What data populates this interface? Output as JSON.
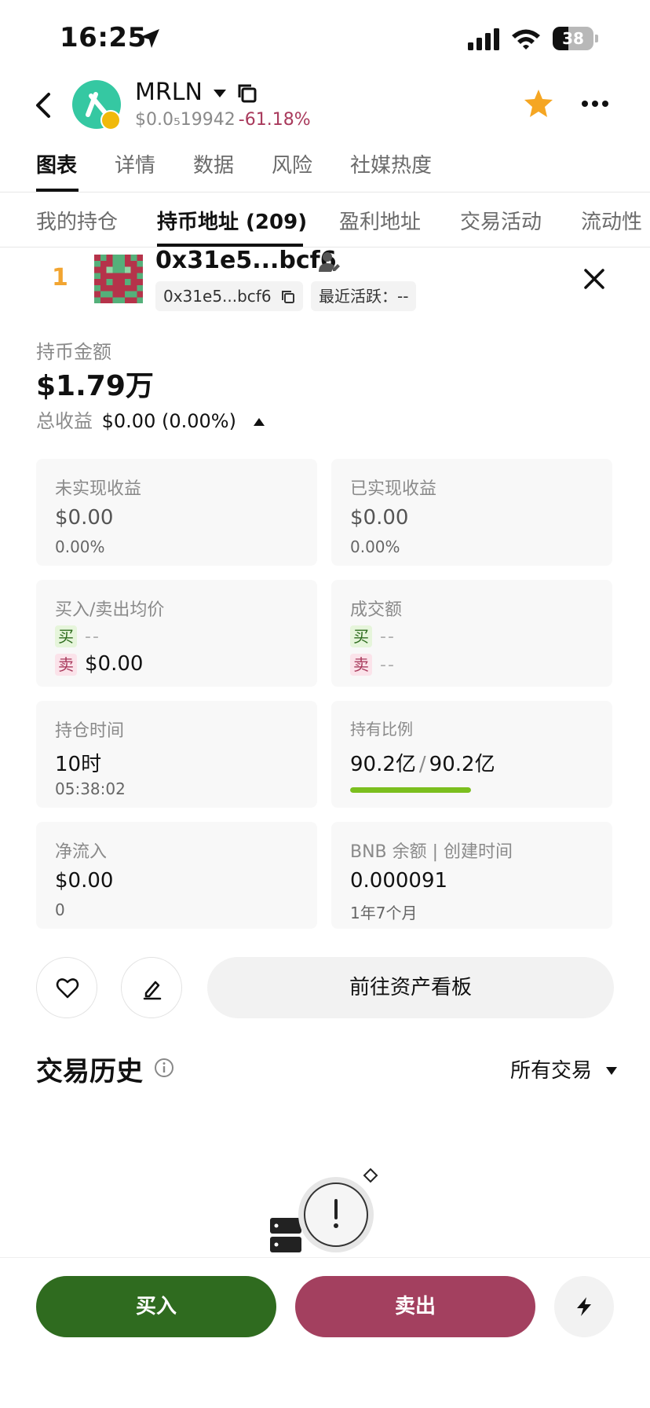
{
  "status_bar": {
    "time": "16:25",
    "battery": "38",
    "battery_level": 0.38
  },
  "header": {
    "symbol": "MRLN",
    "price": "$0.0₅19942",
    "change": "-61.18%",
    "colors": {
      "logo": "#35c8a2",
      "star": "#f5a623",
      "negative": "#a93a5c"
    }
  },
  "tabs": [
    "图表",
    "详情",
    "数据",
    "风险",
    "社媒热度"
  ],
  "subtabs": [
    "我的持仓",
    "持币地址 (209)",
    "盈利地址",
    "交易活动",
    "流动性"
  ],
  "holder": {
    "rank": "1",
    "address": "0x31e5...bcf6",
    "address_chip": "0x31e5...bcf6",
    "last_active": "最近活跃：--"
  },
  "holding": {
    "label": "持币金额",
    "value": "$1.79万",
    "total_label": "总收益",
    "total_value": "$0.00 (0.00%)"
  },
  "cards": {
    "unrealized": {
      "title": "未实现收益",
      "value": "$0.00",
      "sub": "0.00%"
    },
    "realized": {
      "title": "已实现收益",
      "value": "$0.00",
      "sub": "0.00%"
    },
    "avg_price": {
      "title": "买入/卖出均价",
      "buy_tag": "买",
      "buy_value": "--",
      "sell_tag": "卖",
      "sell_value": "$0.00"
    },
    "volume": {
      "title": "成交额",
      "buy_tag": "买",
      "buy_value": "--",
      "sell_tag": "卖",
      "sell_value": "--"
    },
    "hold_time": {
      "title": "持仓时间",
      "value": "10时",
      "sub": "05:38:02"
    },
    "hold_ratio": {
      "title": "持有比例",
      "held": "90.2亿",
      "total": "90.2亿",
      "ratio": 1.0
    },
    "net_inflow": {
      "title": "净流入",
      "value": "$0.00",
      "sub": "0"
    },
    "bnb": {
      "title": "BNB 余额 | 创建时间",
      "value": "0.000091",
      "sub": "1年7个月"
    }
  },
  "actions": {
    "dashboard": "前往资产看板"
  },
  "history": {
    "title": "交易历史",
    "filter": "所有交易"
  },
  "bottom": {
    "buy": "买入",
    "sell": "卖出",
    "colors": {
      "buy": "#2f6b1f",
      "sell": "#a3405f"
    }
  }
}
